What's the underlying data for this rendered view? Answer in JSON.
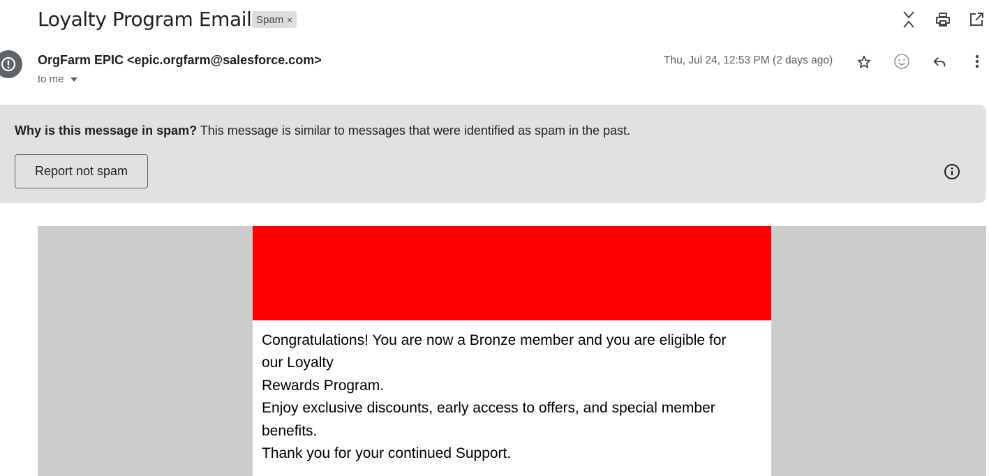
{
  "email": {
    "subject": "Loyalty Program Email",
    "label": "Spam",
    "label_remove": "×",
    "sender": "OrgFarm EPIC <epic.orgfarm@salesforce.com>",
    "recipient": "to me",
    "date": "Thu, Jul 24, 12:53 PM (2 days ago)"
  },
  "spam_notice": {
    "question": "Why is this message in spam?",
    "explanation": " This message is similar to messages that were identified as spam in the past.",
    "button": "Report not spam"
  },
  "message": {
    "banner_color": "#ff0000",
    "lines": [
      "Congratulations! You are now a Bronze member and you are eligible for",
      "our Loyalty",
      "Rewards Program.",
      "Enjoy exclusive discounts, early access to offers, and special member",
      "benefits.",
      "Thank you for your continued Support."
    ]
  },
  "icons": {
    "top": [
      "expand-collapse-icon",
      "print-icon",
      "open-in-new-window-icon"
    ],
    "header": [
      "star-icon",
      "emoji-reaction-icon",
      "reply-icon",
      "more-options-icon"
    ],
    "avatar": "warning-avatar-icon",
    "info": "info-icon"
  }
}
